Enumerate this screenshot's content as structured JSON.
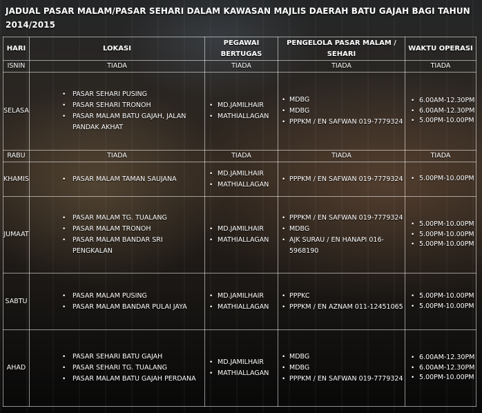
{
  "title": "JADUAL PASAR MALAM/PASAR SEHARI DALAM KAWASAN MAJLIS DAERAH BATU GAJAH BAGI TAHUN 2014/2015",
  "headers": {
    "hari": "HARI",
    "lokasi": "LOKASI",
    "pegawai": "PEGAWAI BERTUGAS",
    "pengelola": "PENGELOLA PASAR MALAM / SEHARI",
    "waktu": "WAKTU OPERASI"
  },
  "rows": [
    {
      "hari": "ISNIN",
      "lokasi": "TIADA",
      "pegawai": "TIADA",
      "pengelola": "TIADA",
      "waktu": "TIADA"
    },
    {
      "hari": "SELASA",
      "lokasi": [
        "PASAR SEHARI PUSING",
        "PASAR SEHARI TRONOH",
        "PASAR MALAM BATU GAJAH, JALAN PANDAK AKHAT"
      ],
      "pegawai": [
        "MD.JAMILHAIR",
        "MATHIALLAGAN"
      ],
      "pengelola": [
        "MDBG",
        "MDBG",
        "PPPKM / EN SAFWAN 019-7779324"
      ],
      "waktu": [
        "6.00AM-12.30PM",
        "6.00AM-12.30PM",
        "5.00PM-10.00PM"
      ]
    },
    {
      "hari": "RABU",
      "lokasi": "TIADA",
      "pegawai": "TIADA",
      "pengelola": "TIADA",
      "waktu": "TIADA"
    },
    {
      "hari": "KHAMIS",
      "lokasi": [
        "PASAR MALAM TAMAN SAUJANA"
      ],
      "pegawai": [
        "MD.JAMILHAIR",
        "MATHIALLAGAN"
      ],
      "pengelola": [
        "PPPKM / EN SAFWAN 019-7779324"
      ],
      "waktu": [
        "5.00PM-10.00PM"
      ]
    },
    {
      "hari": "JUMAAT",
      "lokasi": [
        "PASAR MALAM TG. TUALANG",
        "PASAR MALAM TRONOH",
        "PASAR MALAM BANDAR SRI PENGKALAN"
      ],
      "pegawai": [
        "MD.JAMILHAIR",
        "MATHIALLAGAN"
      ],
      "pengelola": [
        "PPPKM / EN SAFWAN 019-7779324",
        "MDBG",
        "AJK SURAU / EN HANAPI 016-5968190"
      ],
      "waktu": [
        "5.00PM-10.00PM",
        "5.00PM-10.00PM",
        "5.00PM-10.00PM"
      ]
    },
    {
      "hari": "SABTU",
      "lokasi": [
        "PASAR MALAM PUSING",
        "PASAR MALAM BANDAR PULAI JAYA"
      ],
      "pegawai": [
        "MD.JAMILHAIR",
        "MATHIALLAGAN"
      ],
      "pengelola": [
        "PPPKC",
        "PPPKM / EN AZNAM 011-12451065"
      ],
      "waktu": [
        "5.00PM-10.00PM",
        "5.00PM-10.00PM"
      ]
    },
    {
      "hari": "AHAD",
      "lokasi": [
        "PASAR SEHARI BATU GAJAH",
        "PASAR SEHARI TG. TUALANG",
        "PASAR MALAM BATU GAJAH PERDANA"
      ],
      "pegawai": [
        "MD.JAMILHAIR",
        "MATHIALLAGAN"
      ],
      "pengelola": [
        "MDBG",
        "MDBG",
        "PPPKM / EN SAFWAN 019-7779324"
      ],
      "waktu": [
        "6.00AM-12.30PM",
        "6.00AM-12.30PM",
        "5.00PM-10.00PM"
      ]
    }
  ]
}
